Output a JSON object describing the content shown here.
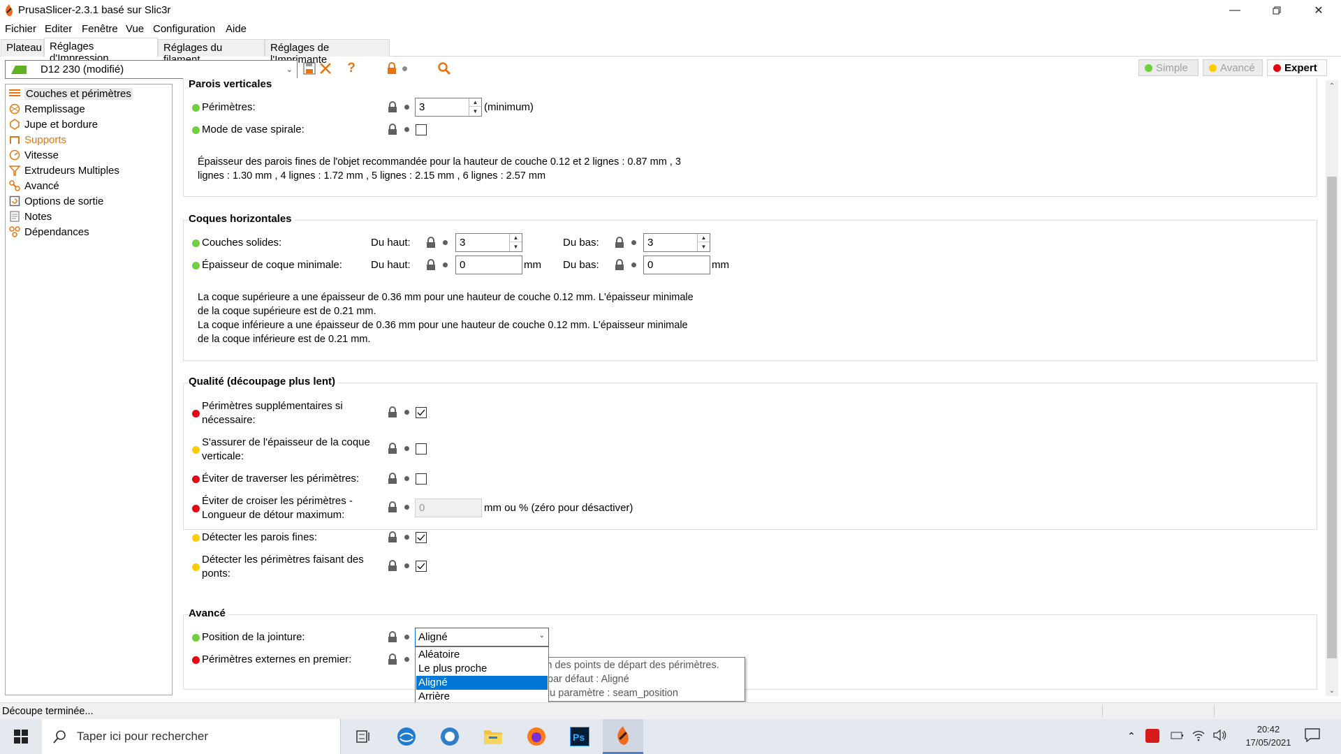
{
  "window": {
    "title": "PrusaSlicer-2.3.1 basé sur Slic3r",
    "buttons": [
      "minimize",
      "maximize",
      "close"
    ]
  },
  "menu": [
    "Fichier",
    "Editer",
    "Fenêtre",
    "Vue",
    "Configuration",
    "Aide"
  ],
  "tabs": [
    "Plateau",
    "Réglages d'Impression",
    "Réglages du filament",
    "Réglages de l'Imprimante"
  ],
  "active_tab": "Réglages d'Impression",
  "toolbar": {
    "preset": "D12 230 (modifié)",
    "icons": [
      "save-icon",
      "delete-icon",
      "help-icon",
      "lock-icon",
      "search-icon"
    ],
    "modes": [
      {
        "label": "Simple",
        "color": "#6cd13a"
      },
      {
        "label": "Avancé",
        "color": "#ffcc00"
      },
      {
        "label": "Expert",
        "color": "#e30613"
      }
    ],
    "active_mode": "Expert"
  },
  "sidebar": {
    "items": [
      {
        "label": "Couches et périmètres",
        "icon": "layers-icon"
      },
      {
        "label": "Remplissage",
        "icon": "infill-icon"
      },
      {
        "label": "Jupe et bordure",
        "icon": "skirt-icon"
      },
      {
        "label": "Supports",
        "icon": "support-icon"
      },
      {
        "label": "Vitesse",
        "icon": "speed-icon"
      },
      {
        "label": "Extrudeurs Multiples",
        "icon": "funnel-icon"
      },
      {
        "label": "Avancé",
        "icon": "wrench-icon"
      },
      {
        "label": "Options de sortie",
        "icon": "output-icon"
      },
      {
        "label": "Notes",
        "icon": "note-icon"
      },
      {
        "label": "Dépendances",
        "icon": "dependencies-icon"
      }
    ],
    "selected": "Couches et périmètres"
  },
  "sections": {
    "vertical": {
      "title": "Parois verticales",
      "perimeters_label": "Périmètres:",
      "perimeters_value": "3",
      "perimeters_suffix": "(minimum)",
      "vase_label": "Mode de vase spirale:",
      "info_line1": "Épaisseur des parois fines de l'objet recommandée pour la hauteur de couche 0.12 et 2 lignes : 0.87 mm , 3",
      "info_line2": "lignes : 1.30 mm , 4 lignes : 1.72 mm , 5 lignes : 2.15 mm , 6 lignes : 2.57 mm"
    },
    "horizontal": {
      "title": "Coques horizontales",
      "solid_label": "Couches solides:",
      "min_label": "Épaisseur de coque minimale:",
      "top_label": "Du haut:",
      "bottom_label": "Du bas:",
      "solid_top": "3",
      "solid_bottom": "3",
      "min_top": "0",
      "min_bottom": "0",
      "unit": "mm",
      "info_line1": "La coque supérieure a une épaisseur de 0.36 mm pour une hauteur de couche 0.12 mm. L'épaisseur minimale",
      "info_line2": "de la coque supérieure est de 0.21 mm.",
      "info_line3": "La coque inférieure a une épaisseur de 0.36 mm pour une hauteur de couche 0.12 mm. L'épaisseur minimale",
      "info_line4": "de la coque inférieure est de 0.21 mm."
    },
    "quality": {
      "title": "Qualité (découpage plus lent)",
      "extra_perim_1": "Périmètres supplémentaires si",
      "extra_perim_2": "nécessaire:",
      "ensure_1": "S'assurer de l'épaisseur de la coque",
      "ensure_2": "verticale:",
      "avoid_cross": "Éviter de traverser les périmètres:",
      "avoid_detour_1": "Éviter de croiser les périmètres -",
      "avoid_detour_2": "Longueur de détour maximum:",
      "avoid_detour_value": "0",
      "avoid_detour_suffix": "mm ou % (zéro pour désactiver)",
      "thin_walls": "Détecter les parois fines:",
      "bridge_1": "Détecter les périmètres faisant des",
      "bridge_2": "ponts:"
    },
    "advanced": {
      "title": "Avancé",
      "seam_label": "Position de la jointure:",
      "seam_value": "Aligné",
      "external_first": "Périmètres externes en premier:"
    }
  },
  "dropdown": {
    "options": [
      "Aléatoire",
      "Le plus proche",
      "Aligné",
      "Arrière"
    ],
    "selected": "Aligné"
  },
  "tooltip": {
    "line1": "tion des points de départ des périmètres.",
    "line2": "ur par défaut     : Aligné",
    "line3": "n du paramètre : seam_position"
  },
  "status": "Découpe terminée...",
  "taskbar": {
    "search_placeholder": "Taper ici pour rechercher",
    "time": "20:42",
    "date": "17/05/2021"
  }
}
